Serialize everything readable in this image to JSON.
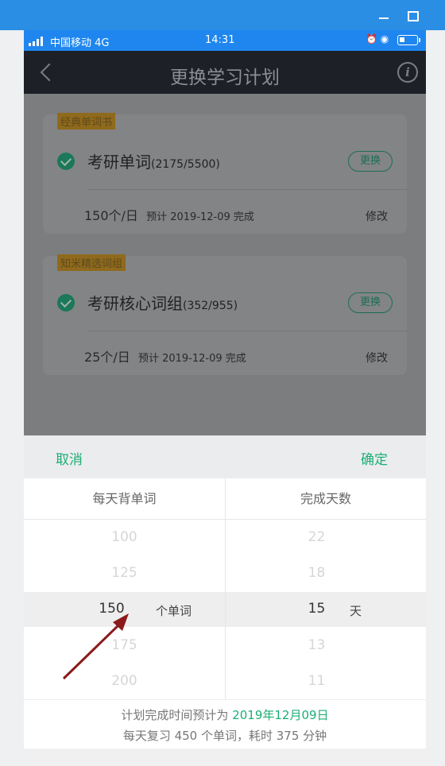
{
  "status_bar": {
    "carrier": "中国移动 4G",
    "time": "14:31"
  },
  "nav": {
    "title": "更换学习计划"
  },
  "cards": [
    {
      "tag": "经典单词书",
      "book": "考研单词",
      "progress": "(2175/5500)",
      "swap_label": "更换",
      "daily": "150个/日",
      "estimate": "预计 2019-12-09 完成",
      "modify_label": "修改"
    },
    {
      "tag": "知米精选词组",
      "book": "考研核心词组",
      "progress": "(352/955)",
      "swap_label": "更换",
      "daily": "25个/日",
      "estimate": "预计 2019-12-09 完成",
      "modify_label": "修改"
    }
  ],
  "picker": {
    "cancel_label": "取消",
    "confirm_label": "确定",
    "left_header": "每天背单词",
    "right_header": "完成天数",
    "left_values": [
      "100",
      "125",
      "150",
      "175",
      "200"
    ],
    "right_values": [
      "22",
      "18",
      "15",
      "13",
      "11"
    ],
    "left_unit": "个单词",
    "right_unit": "天",
    "footer_prefix": "计划完成时间预计为",
    "footer_date": "2019年12月09日",
    "footer_line2": "每天复习 450 个单词，耗时 375 分钟"
  },
  "colors": {
    "accent_green": "#1cae75",
    "status_blue": "#1f86ef",
    "arrow_red": "#8b1a1a"
  }
}
